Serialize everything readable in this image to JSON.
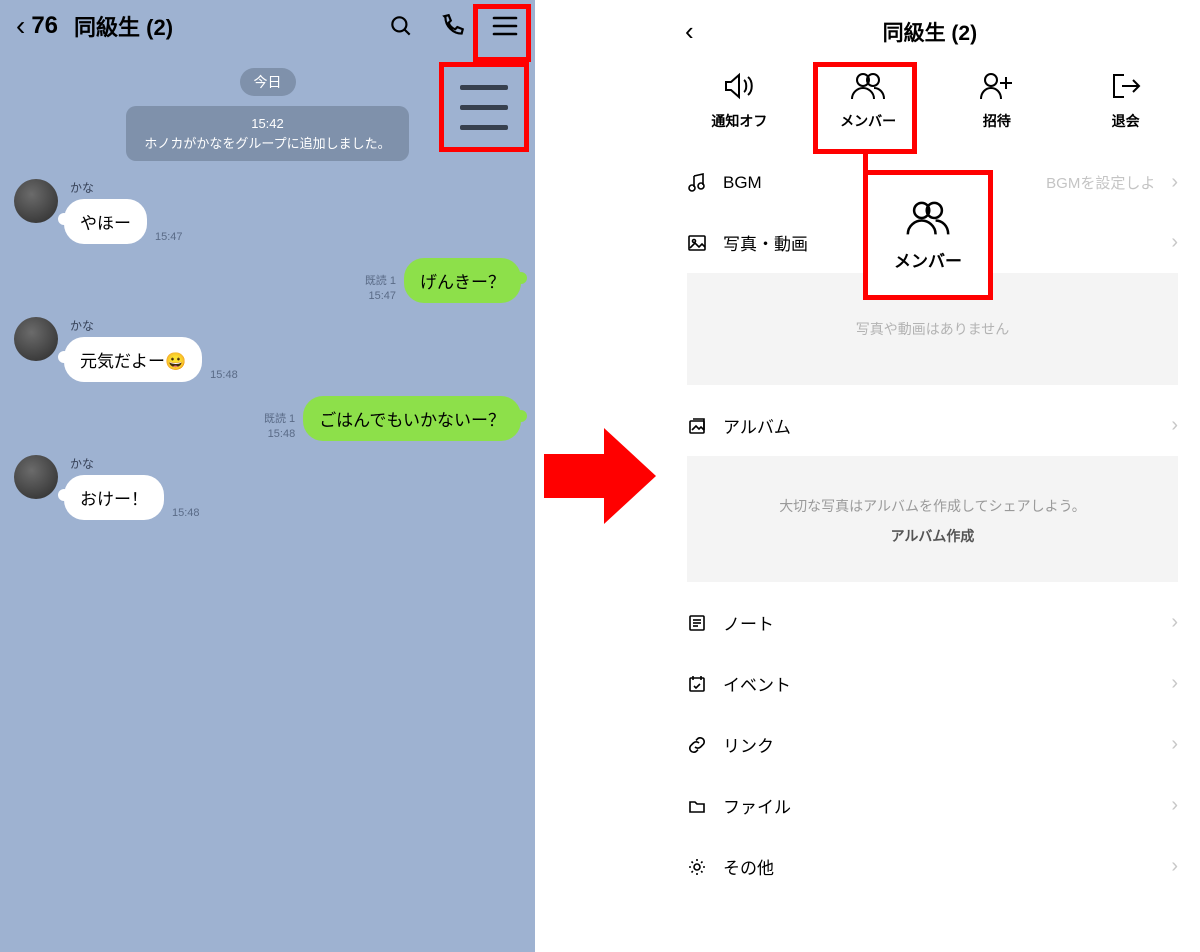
{
  "left": {
    "back_unread": "76",
    "title": "同級生 (2)",
    "date_label": "今日",
    "system": {
      "time": "15:42",
      "text": "ホノカがかなをグループに追加しました。"
    },
    "messages": [
      {
        "side": "other",
        "sender": "かな",
        "text": "やほー",
        "time": "15:47"
      },
      {
        "side": "mine",
        "read": "既読 1",
        "time": "15:47",
        "text": "げんきー？"
      },
      {
        "side": "other",
        "sender": "かな",
        "text": "元気だよー😀",
        "time": "15:48"
      },
      {
        "side": "mine",
        "read": "既読 1",
        "time": "15:48",
        "text": "ごはんでもいかないー？"
      },
      {
        "side": "other",
        "sender": "かな",
        "text": "おけー！",
        "time": "15:48"
      }
    ]
  },
  "right": {
    "title": "同級生 (2)",
    "actions": {
      "mute": "通知オフ",
      "members": "メンバー",
      "invite": "招待",
      "leave": "退会"
    },
    "bgm": {
      "label": "BGM",
      "hint": "BGMを設定しよ"
    },
    "photos": {
      "label": "写真・動画",
      "empty": "写真や動画はありません"
    },
    "album": {
      "label": "アルバム",
      "empty": "大切な写真はアルバムを作成してシェアしよう。",
      "cta": "アルバム作成"
    },
    "items": {
      "note": "ノート",
      "event": "イベント",
      "link": "リンク",
      "file": "ファイル",
      "other": "その他"
    },
    "callout_label": "メンバー"
  }
}
